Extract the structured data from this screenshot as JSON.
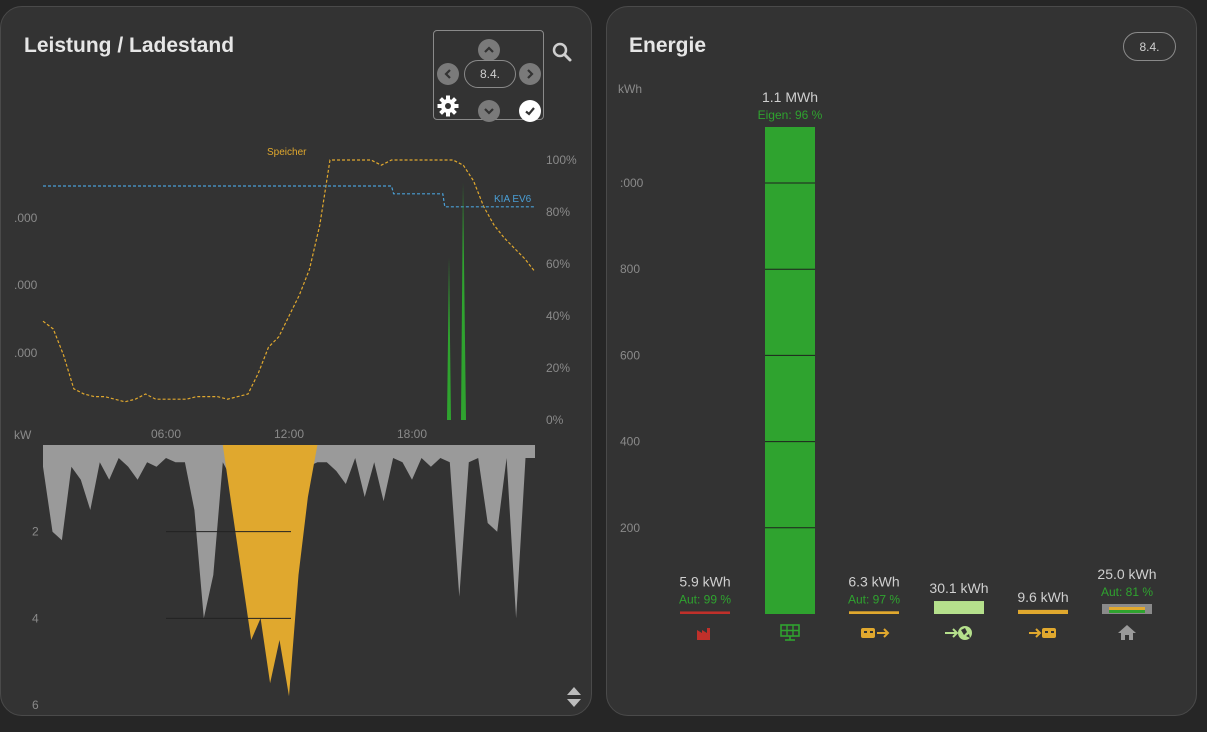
{
  "power_card": {
    "title": "Leistung / Ladestand",
    "nav": {
      "date": "8.4.",
      "up_icon": "chevron-up-icon",
      "down_icon": "chevron-down-icon",
      "prev_icon": "chevron-left-icon",
      "next_icon": "chevron-right-icon",
      "settings_icon": "gear-icon",
      "confirm_icon": "check-icon"
    },
    "search_icon": "magnifier-icon",
    "sort_icon": "sort-updown-icon",
    "colors": {
      "solar": "#2fa32f",
      "storage": "#e0a82e",
      "house": "#9a9a9a",
      "ev": "#4a9fd6"
    }
  },
  "chart_data": [
    {
      "type": "line",
      "x_tick_labels": [
        "06:00",
        "12:00",
        "18:00"
      ],
      "left_tick_labels": [
        ".000",
        ".000",
        ".000"
      ],
      "right_axis_ticks": [
        "100%",
        "80%",
        "60%",
        "40%",
        "20%",
        "0%"
      ],
      "ylim_right": [
        0,
        100
      ],
      "series": [
        {
          "name": "Speicher",
          "color": "#e0a82e",
          "style": "dashed",
          "x": [
            0,
            0.5,
            1,
            1.5,
            2,
            2.5,
            3,
            3.5,
            4,
            4.5,
            5,
            5.5,
            6,
            6.5,
            7,
            7.5,
            8,
            8.5,
            9,
            9.5,
            10,
            10.5,
            11,
            11.5,
            12,
            12.5,
            13,
            13.5,
            14,
            14.5,
            15,
            15.5,
            16,
            16.5,
            17,
            17.5,
            18,
            18.5,
            19,
            19.5,
            20,
            20.5,
            21,
            21.5,
            22,
            22.5,
            23,
            23.5,
            24
          ],
          "values": [
            38,
            35,
            25,
            12,
            10,
            9,
            9,
            8,
            7,
            8,
            10,
            8,
            8,
            8,
            8,
            9,
            9,
            9,
            8,
            9,
            10,
            18,
            28,
            32,
            40,
            48,
            58,
            75,
            100,
            100,
            100,
            100,
            100,
            98,
            100,
            100,
            100,
            100,
            100,
            100,
            100,
            98,
            92,
            82,
            75,
            70,
            66,
            62,
            57
          ]
        },
        {
          "name": "KIA EV6",
          "color": "#4a9fd6",
          "style": "dashed",
          "x": [
            0,
            17,
            17.1,
            19.5,
            19.6,
            24
          ],
          "values": [
            90,
            90,
            87,
            87,
            82,
            82
          ]
        }
      ]
    },
    {
      "type": "area",
      "ylabel": "kW",
      "y_ticks": [
        2,
        4,
        6
      ],
      "ylim": [
        0,
        6
      ],
      "series": [
        {
          "name": "",
          "color": "#9a9a9a",
          "values": [
            0.5,
            2,
            2.2,
            0.5,
            0.8,
            1.5,
            0.4,
            0.8,
            0.3,
            0.5,
            0.8,
            0.4,
            0.5,
            0.3,
            0.4,
            0.4,
            1.5,
            4,
            3,
            0.4,
            0.8,
            1.5,
            0.8,
            2,
            0.4,
            0.4,
            1.3,
            2,
            0.5,
            0.4,
            0.4,
            0.6,
            0.9,
            0.3,
            1.2,
            0.4,
            1.3,
            0.3,
            0.4,
            0.8,
            0.3,
            0.5,
            0.3,
            0.4,
            3.5,
            0.4,
            0.3,
            1.8,
            2,
            0.3,
            4,
            0.3,
            0.3
          ]
        },
        {
          "name": "",
          "color": "#e0a82e",
          "values": [
            0,
            0,
            0,
            0,
            0,
            0,
            0,
            0,
            0,
            0,
            0,
            0,
            0,
            0,
            0,
            0,
            0,
            0,
            0,
            0,
            1.5,
            3,
            4.5,
            4,
            5.5,
            4.5,
            5.8,
            3,
            1.2,
            0,
            0,
            0,
            0,
            0,
            0,
            0,
            0,
            0,
            0,
            0,
            0,
            0,
            0,
            0,
            0,
            0,
            0,
            0,
            0,
            0,
            0,
            0,
            0
          ]
        }
      ]
    },
    {
      "type": "bar",
      "ylabel": "kWh",
      "y_tick_labels": [
        ":000",
        "800",
        "600",
        "400",
        "200"
      ],
      "ylim": [
        0,
        1130
      ],
      "categories": [
        {
          "value_label": "5.9 kWh",
          "sub_label": "Aut: 99 %",
          "value": 5.9,
          "color": "#c0302a",
          "icon": "factory-icon",
          "icon_color": "#c0302a"
        },
        {
          "value_label": "1.1 MWh",
          "sub_label": "Eigen: 96 %",
          "value": 1130,
          "color": "#2fa32f",
          "icon": "solar-panel-icon",
          "icon_color": "#2fa32f"
        },
        {
          "value_label": "6.3 kWh",
          "sub_label": "Aut: 97 %",
          "value": 6.3,
          "color": "#e0a82e",
          "icon": "battery-out-icon",
          "icon_color": "#e0a82e"
        },
        {
          "value_label": "30.1 kWh",
          "sub_label": "",
          "value": 30.1,
          "color": "#b5e08c",
          "icon": "grid-feed-in-icon",
          "icon_color": "#b5e08c"
        },
        {
          "value_label": "9.6 kWh",
          "sub_label": "",
          "value": 9.6,
          "color": "#e0a82e",
          "icon": "battery-in-icon",
          "icon_color": "#e0a82e"
        },
        {
          "value_label": "25.0 kWh",
          "sub_label": "Aut: 81 %",
          "value": 25.0,
          "color": "#8a8a8a",
          "icon": "house-icon",
          "icon_color": "#9a9a9a"
        }
      ]
    }
  ],
  "energy_card": {
    "title": "Energie",
    "date": "8.4."
  }
}
